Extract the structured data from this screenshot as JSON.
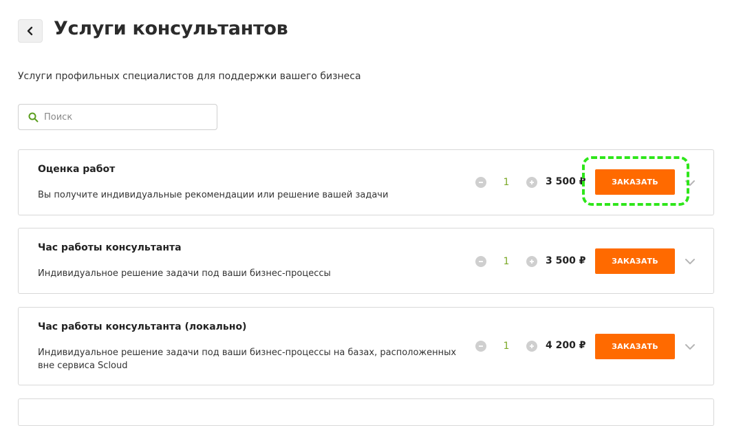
{
  "header": {
    "title": "Услуги консультантов",
    "subtitle": "Услуги профильных специалистов для поддержки вашего бизнеса"
  },
  "search": {
    "placeholder": "Поиск",
    "value": ""
  },
  "services": [
    {
      "title": "Оценка работ",
      "description": "Вы получите индивидуальные рекомендации или решение вашей задачи",
      "quantity": "1",
      "price": "3 500 ₽",
      "order_label": "ЗАКАЗАТЬ"
    },
    {
      "title": "Час работы консультанта",
      "description": "Индивидуальное решение задачи под ваши бизнес-процессы",
      "quantity": "1",
      "price": "3 500 ₽",
      "order_label": "ЗАКАЗАТЬ"
    },
    {
      "title": "Час работы консультанта (локально)",
      "description": "Индивидуальное решение задачи под ваши бизнес-процессы на базах, расположенных вне сервиса Scloud",
      "quantity": "1",
      "price": "4 200 ₽",
      "order_label": "ЗАКАЗАТЬ"
    }
  ],
  "colors": {
    "accent": "#ff6a00",
    "quantity_text": "#7aa826",
    "search_icon": "#5a9e1e",
    "highlight": "#2ee61a"
  },
  "icons": {
    "back": "chevron-left-icon",
    "search": "search-icon",
    "minus": "minus-icon",
    "plus": "plus-icon",
    "expand": "chevron-down-icon"
  }
}
